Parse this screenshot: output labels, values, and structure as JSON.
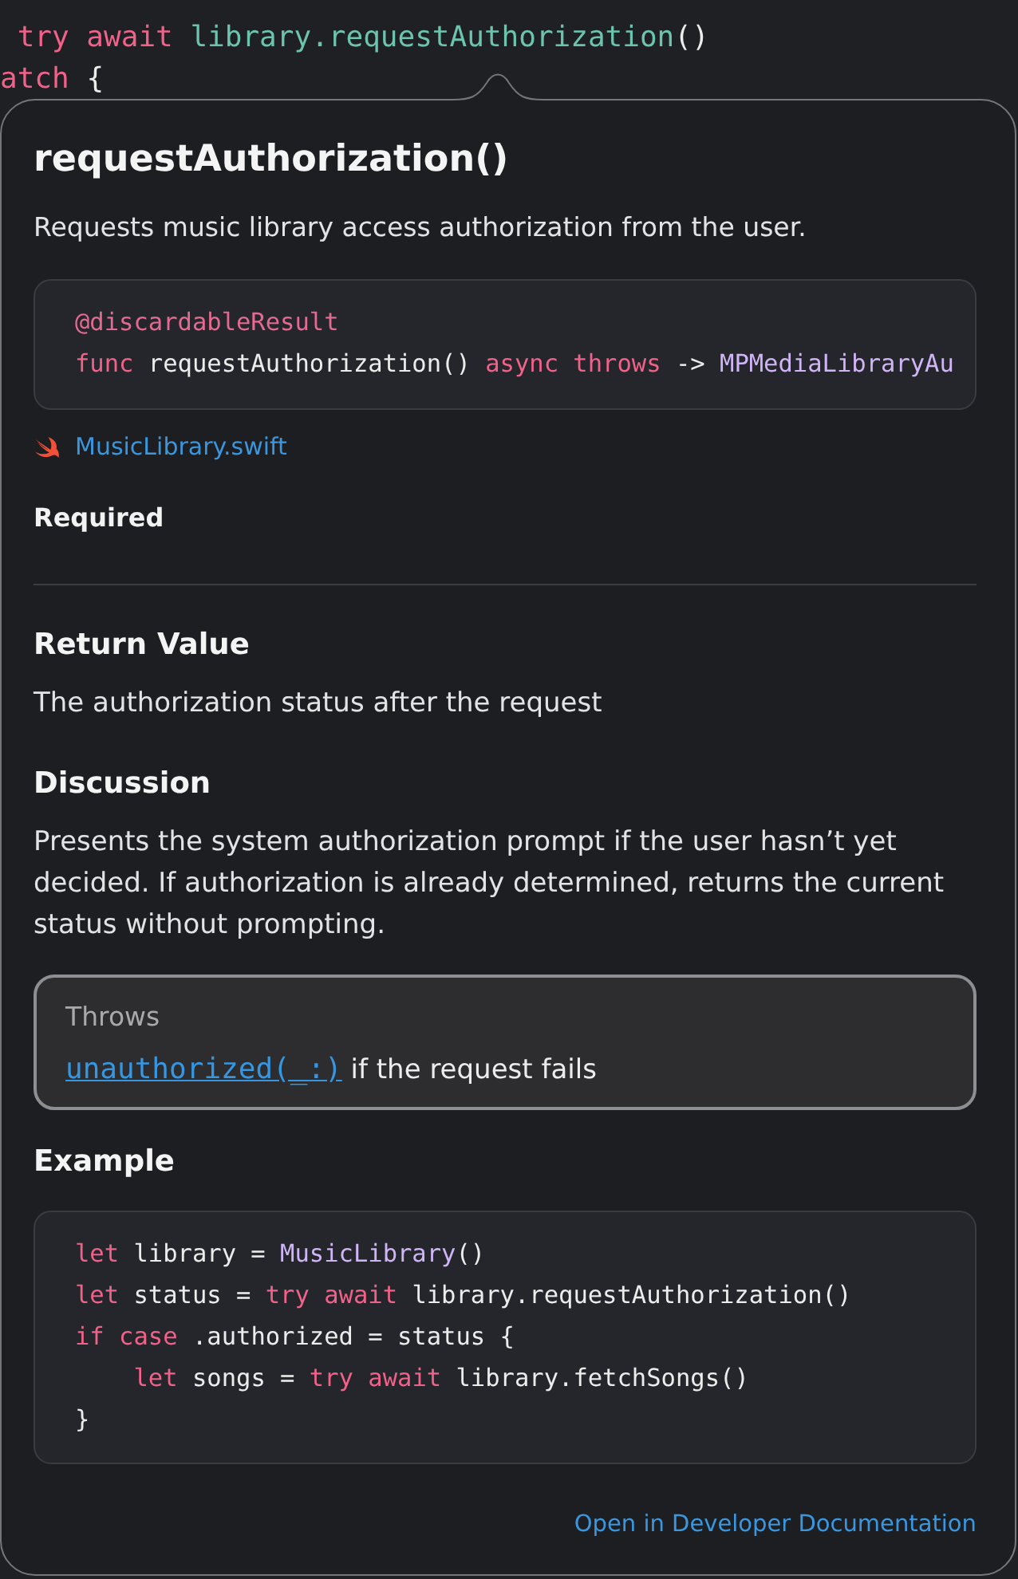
{
  "editor": {
    "lines": [
      [
        {
          "kind": "keyword",
          "text": " try await"
        },
        {
          "kind": "project_symbol",
          "text": " library.requestAuthorization"
        },
        {
          "kind": "plain",
          "text": "()"
        }
      ],
      [
        {
          "kind": "keyword",
          "text": "atch"
        },
        {
          "kind": "plain",
          "text": " {"
        }
      ]
    ]
  },
  "popover": {
    "title": "requestAuthorization()",
    "summary": "Requests music library access authorization from the user.",
    "declaration": {
      "lines": [
        [
          {
            "kind": "attribute",
            "text": "@discardableResult"
          }
        ],
        [
          {
            "kind": "keyword",
            "text": "func"
          },
          {
            "kind": "plain",
            "text": " requestAuthorization() "
          },
          {
            "kind": "keyword",
            "text": "async throws"
          },
          {
            "kind": "plain",
            "text": " -> "
          },
          {
            "kind": "type",
            "text": "MPMediaLibraryAu"
          }
        ]
      ]
    },
    "source_file": "MusicLibrary.swift",
    "required_label": "Required",
    "sections": [
      {
        "kind": "text",
        "heading": "Return Value",
        "body": "The authorization status after the request"
      },
      {
        "kind": "text",
        "heading": "Discussion",
        "body": "Presents the system authorization prompt if the user hasn’t yet decided. If authorization is already determined, returns the current status without prompting."
      },
      {
        "kind": "callout",
        "heading": "Throws",
        "link": "unauthorized(_:)",
        "body": "if the request fails"
      },
      {
        "kind": "code",
        "heading": "Example",
        "lines": [
          [
            {
              "kind": "keyword",
              "text": "let"
            },
            {
              "kind": "plain",
              "text": " library = "
            },
            {
              "kind": "type",
              "text": "MusicLibrary"
            },
            {
              "kind": "plain",
              "text": "()"
            }
          ],
          [
            {
              "kind": "keyword",
              "text": "let"
            },
            {
              "kind": "plain",
              "text": " status = "
            },
            {
              "kind": "keyword",
              "text": "try await"
            },
            {
              "kind": "plain",
              "text": " library.requestAuthorization()"
            }
          ],
          [
            {
              "kind": "keyword",
              "text": "if case"
            },
            {
              "kind": "plain",
              "text": " .authorized = status {"
            }
          ],
          [
            {
              "kind": "keyword",
              "text": "    let"
            },
            {
              "kind": "plain",
              "text": " songs = "
            },
            {
              "kind": "keyword",
              "text": "try await"
            },
            {
              "kind": "plain",
              "text": " library.fetchSongs()"
            }
          ],
          [
            {
              "kind": "plain",
              "text": "}"
            }
          ]
        ]
      }
    ],
    "footer_link": "Open in Developer Documentation"
  }
}
